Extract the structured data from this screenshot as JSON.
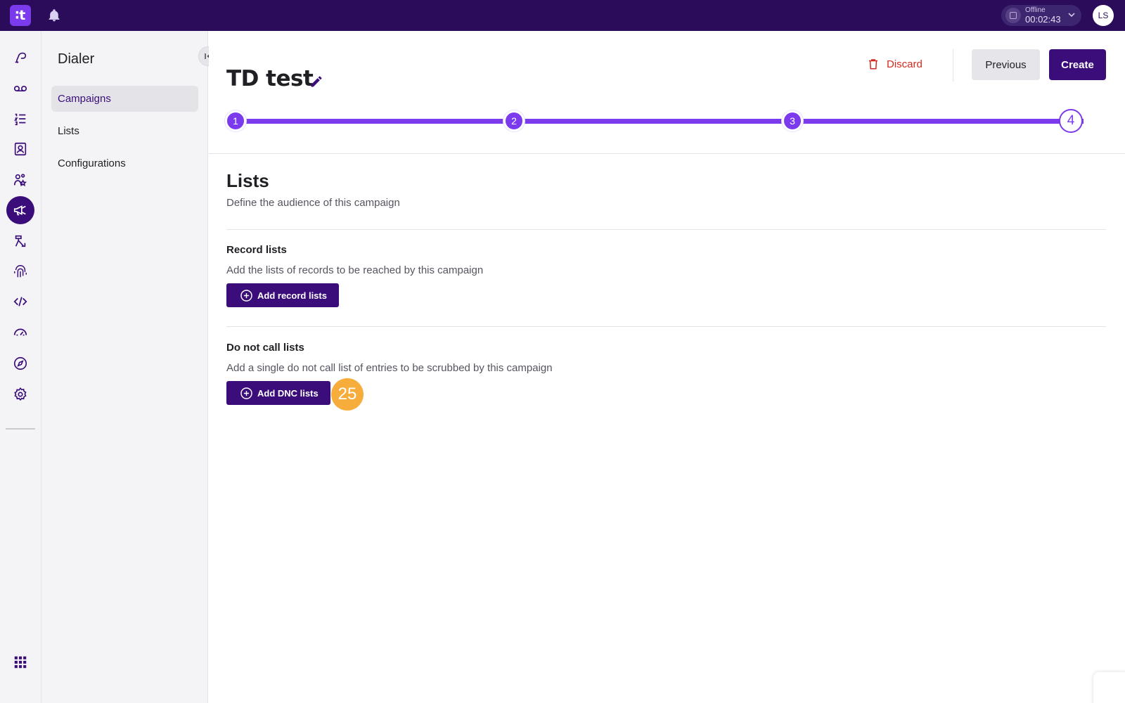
{
  "app": {
    "logo_text": "∶t",
    "status": {
      "label": "Offline",
      "time": "00:02:43"
    },
    "user_initials": "LS"
  },
  "rail": {
    "icons": [
      "conversations-icon",
      "voicemail-icon",
      "queues-icon",
      "contacts-icon",
      "teams-icon",
      "dialer-icon",
      "routing-icon",
      "identity-icon",
      "developer-icon",
      "dashboard-icon",
      "explore-icon",
      "settings-icon",
      "apps-grid-icon"
    ],
    "active": "dialer-icon"
  },
  "subnav": {
    "title": "Dialer",
    "items": [
      {
        "label": "Campaigns",
        "active": true
      },
      {
        "label": "Lists",
        "active": false
      },
      {
        "label": "Configurations",
        "active": false
      }
    ]
  },
  "header": {
    "title": "TD test",
    "discard_label": "Discard",
    "previous_label": "Previous",
    "create_label": "Create"
  },
  "stepper": {
    "steps": [
      "1",
      "2",
      "3",
      "4"
    ],
    "current_step": 4
  },
  "section": {
    "title": "Lists",
    "subtitle": "Define the audience of this campaign"
  },
  "record_lists": {
    "title": "Record lists",
    "description": "Add the lists of records to be reached by this campaign",
    "button_label": "Add record lists"
  },
  "dnc_lists": {
    "title": "Do not call lists",
    "description": "Add a single do not call list of entries to be scrubbed by this campaign",
    "button_label": "Add DNC lists"
  },
  "annotation_badge": "25",
  "colors": {
    "topbar": "#2a0c5b",
    "primary": "#3b0d7a",
    "accent": "#7c3aed",
    "danger": "#d3281f",
    "badge": "#f6ad3c"
  }
}
